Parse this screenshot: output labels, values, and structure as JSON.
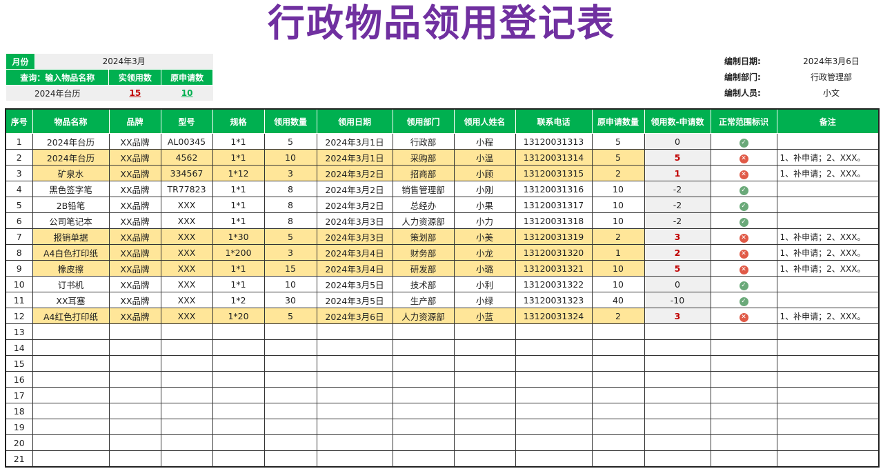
{
  "title": "行政物品领用登记表",
  "query": {
    "month_label": "月份",
    "month_value": "2024年3月",
    "search_label": "查询：输入物品名称",
    "actual_label": "实领用数",
    "requested_label": "原申请数",
    "search_value": "2024年台历",
    "actual_value": "15",
    "requested_value": "10"
  },
  "meta": {
    "date_label": "编制日期:",
    "date_value": "2024年3月6日",
    "dept_label": "编制部门:",
    "dept_value": "行政管理部",
    "person_label": "编制人员:",
    "person_value": "小文"
  },
  "columns": [
    "序号",
    "物品名称",
    "品牌",
    "型号",
    "规格",
    "领用数量",
    "领用日期",
    "领用部门",
    "领用人姓名",
    "联系电话",
    "原申请数量",
    "领用数-申请数",
    "正常范围标识",
    "备注"
  ],
  "rows": [
    {
      "no": "1",
      "name": "2024年台历",
      "brand": "XX品牌",
      "model": "AL00345",
      "spec": "1*1",
      "qty": "5",
      "date": "2024年3月1日",
      "dept": "行政部",
      "person": "小程",
      "phone": "13120031313",
      "req": "5",
      "diff": "0",
      "status": "ok",
      "note": "",
      "hl": false
    },
    {
      "no": "2",
      "name": "2024年台历",
      "brand": "XX品牌",
      "model": "4562",
      "spec": "1*1",
      "qty": "10",
      "date": "2024年3月1日",
      "dept": "采购部",
      "person": "小温",
      "phone": "13120031314",
      "req": "5",
      "diff": "5",
      "status": "bad",
      "note": "1、补申请；2、XXX。",
      "hl": true
    },
    {
      "no": "3",
      "name": "矿泉水",
      "brand": "XX品牌",
      "model": "334567",
      "spec": "1*12",
      "qty": "3",
      "date": "2024年3月2日",
      "dept": "招商部",
      "person": "小顾",
      "phone": "13120031315",
      "req": "2",
      "diff": "1",
      "status": "bad",
      "note": "1、补申请；2、XXX。",
      "hl": true
    },
    {
      "no": "4",
      "name": "黑色签字笔",
      "brand": "XX品牌",
      "model": "TR77823",
      "spec": "1*1",
      "qty": "8",
      "date": "2024年3月2日",
      "dept": "销售管理部",
      "person": "小刚",
      "phone": "13120031316",
      "req": "10",
      "diff": "-2",
      "status": "ok",
      "note": "",
      "hl": false
    },
    {
      "no": "5",
      "name": "2B铅笔",
      "brand": "XX品牌",
      "model": "XXX",
      "spec": "1*1",
      "qty": "8",
      "date": "2024年3月2日",
      "dept": "总经办",
      "person": "小果",
      "phone": "13120031317",
      "req": "10",
      "diff": "-2",
      "status": "ok",
      "note": "",
      "hl": false
    },
    {
      "no": "6",
      "name": "公司笔记本",
      "brand": "XX品牌",
      "model": "XXX",
      "spec": "1*1",
      "qty": "8",
      "date": "2024年3月3日",
      "dept": "人力资源部",
      "person": "小力",
      "phone": "13120031318",
      "req": "10",
      "diff": "-2",
      "status": "ok",
      "note": "",
      "hl": false
    },
    {
      "no": "7",
      "name": "报销单据",
      "brand": "XX品牌",
      "model": "XXX",
      "spec": "1*30",
      "qty": "5",
      "date": "2024年3月3日",
      "dept": "策划部",
      "person": "小美",
      "phone": "13120031319",
      "req": "2",
      "diff": "3",
      "status": "bad",
      "note": "1、补申请；2、XXX。",
      "hl": true
    },
    {
      "no": "8",
      "name": "A4白色打印纸",
      "brand": "XX品牌",
      "model": "XXX",
      "spec": "1*200",
      "qty": "3",
      "date": "2024年3月4日",
      "dept": "财务部",
      "person": "小龙",
      "phone": "13120031320",
      "req": "1",
      "diff": "2",
      "status": "bad",
      "note": "1、补申请；2、XXX。",
      "hl": true
    },
    {
      "no": "9",
      "name": "橡皮擦",
      "brand": "XX品牌",
      "model": "XXX",
      "spec": "1*1",
      "qty": "15",
      "date": "2024年3月4日",
      "dept": "研发部",
      "person": "小璐",
      "phone": "13120031321",
      "req": "10",
      "diff": "5",
      "status": "bad",
      "note": "1、补申请；2、XXX。",
      "hl": true
    },
    {
      "no": "10",
      "name": "订书机",
      "brand": "XX品牌",
      "model": "XXX",
      "spec": "1*1",
      "qty": "10",
      "date": "2024年3月5日",
      "dept": "技术部",
      "person": "小利",
      "phone": "13120031322",
      "req": "10",
      "diff": "0",
      "status": "ok",
      "note": "",
      "hl": false
    },
    {
      "no": "11",
      "name": "XX耳塞",
      "brand": "XX品牌",
      "model": "XXX",
      "spec": "1*2",
      "qty": "30",
      "date": "2024年3月5日",
      "dept": "生产部",
      "person": "小绿",
      "phone": "13120031323",
      "req": "40",
      "diff": "-10",
      "status": "ok",
      "note": "",
      "hl": false
    },
    {
      "no": "12",
      "name": "A4红色打印纸",
      "brand": "XX品牌",
      "model": "XXX",
      "spec": "1*20",
      "qty": "5",
      "date": "2024年3月6日",
      "dept": "人力资源部",
      "person": "小蓝",
      "phone": "13120031324",
      "req": "2",
      "diff": "3",
      "status": "bad",
      "note": "1、补申请；2、XXX。",
      "hl": true
    }
  ],
  "empty_rows": [
    "13",
    "14",
    "15",
    "16",
    "17",
    "18",
    "19",
    "20",
    "21"
  ],
  "icons": {
    "ok": "check-circle-icon",
    "bad": "x-circle-icon"
  },
  "colors": {
    "header_green": "#00b050",
    "highlight": "#ffe699",
    "title_purple": "#7030a0",
    "error_red": "#c00000"
  }
}
